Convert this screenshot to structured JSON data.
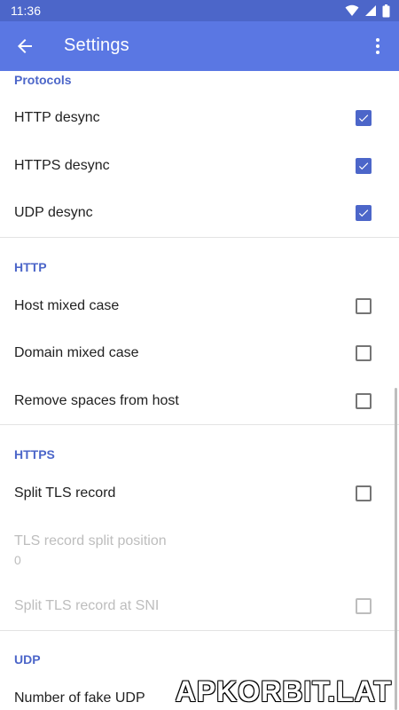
{
  "status_bar": {
    "time": "11:36"
  },
  "app_bar": {
    "title": "Settings"
  },
  "sections": {
    "protocols": {
      "title": "Protocols",
      "items": [
        {
          "label": "HTTP desync",
          "checked": true
        },
        {
          "label": "HTTPS desync",
          "checked": true
        },
        {
          "label": "UDP desync",
          "checked": true
        }
      ]
    },
    "http": {
      "title": "HTTP",
      "items": [
        {
          "label": "Host mixed case",
          "checked": false
        },
        {
          "label": "Domain mixed case",
          "checked": false
        },
        {
          "label": "Remove spaces from host",
          "checked": false
        }
      ]
    },
    "https": {
      "title": "HTTPS",
      "split_tls_record": {
        "label": "Split TLS record",
        "checked": false
      },
      "split_position": {
        "label": "TLS record split position",
        "value": "0"
      },
      "split_at_sni": {
        "label": "Split TLS record at SNI",
        "checked": false
      }
    },
    "udp": {
      "title": "UDP",
      "fake_udp": {
        "label": "Number of fake UDP"
      }
    }
  },
  "watermark": "APKORBIT.LAT",
  "colors": {
    "primary": "#5a77e3",
    "status": "#4c66c9",
    "accent": "#4c66c9"
  }
}
